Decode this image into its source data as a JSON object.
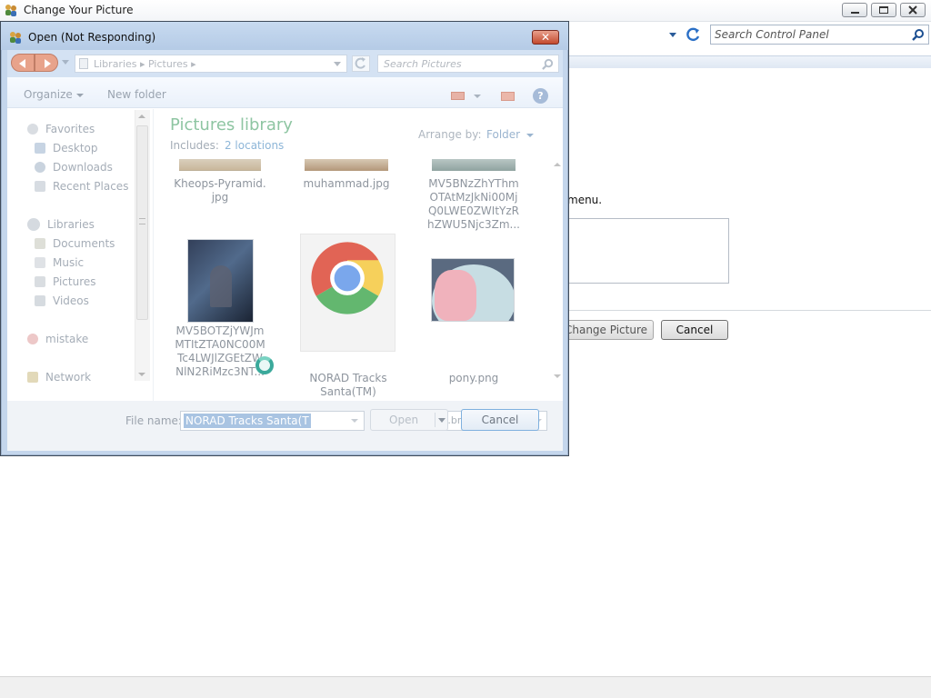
{
  "main_window": {
    "title": "Change Your Picture",
    "search_placeholder": "Search Control Panel",
    "menu_fragment": "menu.",
    "change_picture_label": "Change Picture",
    "cancel_label": "Cancel"
  },
  "open_dialog": {
    "title": "Open (Not Responding)",
    "close_glyph": "✕",
    "breadcrumb": [
      "Libraries",
      "Pictures"
    ],
    "breadcrumb_text": "Libraries  ▸  Pictures  ▸",
    "search_placeholder": "Search Pictures",
    "toolbar": {
      "organize_label": "Organize",
      "new_folder_label": "New folder",
      "help_glyph": "?"
    },
    "nav": {
      "favorites": "Favorites",
      "desktop": "Desktop",
      "downloads": "Downloads",
      "recent_places": "Recent Places",
      "libraries": "Libraries",
      "documents": "Documents",
      "music": "Music",
      "pictures": "Pictures",
      "videos": "Videos",
      "homegroup": "mistake",
      "network": "Network"
    },
    "library": {
      "title": "Pictures library",
      "includes_label": "Includes:",
      "locations_link": "2 locations",
      "arrange_label": "Arrange by:",
      "arrange_value": "Folder"
    },
    "files": [
      {
        "name": "Kheops-Pyramid.\njpg",
        "icon": "image-thumbnail"
      },
      {
        "name": "muhammad.jpg",
        "icon": "image-thumbnail"
      },
      {
        "name": "MV5BNzZhYThm\nOTAtMzJkNi00Mj\nQ0LWE0ZWItYzR\nhZWU5Njc3Zm...",
        "icon": "image-thumbnail"
      },
      {
        "name": "MV5BOTZjYWJm\nMTItZTA0NC00M\nTc4LWJlZGEtZW\nNlN2RiMzc3NT...",
        "icon": "movie-poster-thumbnail"
      },
      {
        "name": "NORAD Tracks\nSanta(TM)",
        "icon": "chrome-icon"
      },
      {
        "name": "pony.png",
        "icon": "pony-thumbnail"
      }
    ],
    "file_name_label": "File name:",
    "file_name_value": "NORAD Tracks Santa(TM)",
    "file_type_value": "Image Files (*.bmp,*.gif,*.jpg,*.",
    "open_label": "Open",
    "cancel_label": "Cancel"
  }
}
